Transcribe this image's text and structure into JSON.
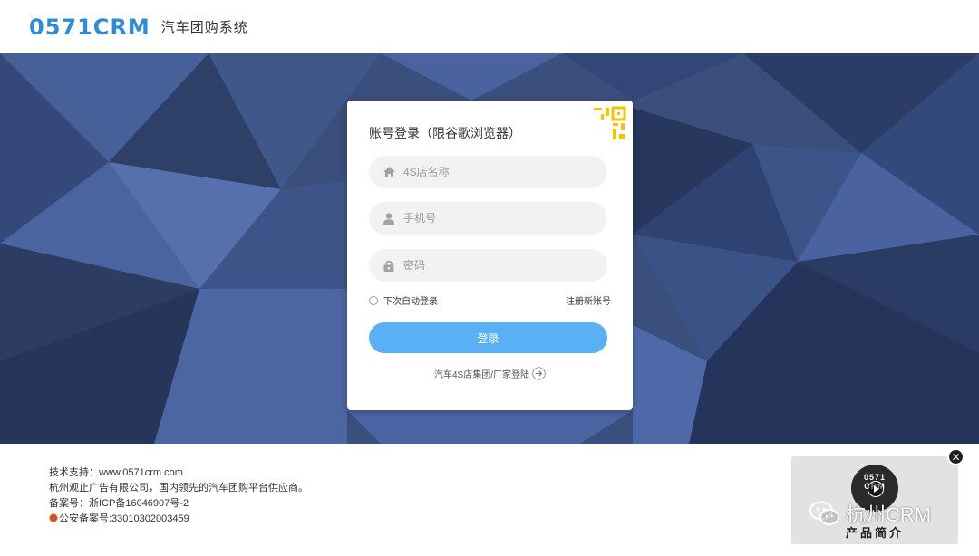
{
  "header": {
    "logo": "0571CRM",
    "title": "汽车团购系统"
  },
  "login": {
    "title": "账号登录（限谷歌浏览器）",
    "store_placeholder": "4S店名称",
    "phone_placeholder": "手机号",
    "password_placeholder": "密码",
    "remember_label": "下次自动登录",
    "register_label": "注册新账号",
    "submit_label": "登录",
    "group_login_label": "汽车4S店集团/厂家登陆"
  },
  "footer": {
    "support": "技术支持：www.0571crm.com",
    "company": "杭州观止广告有限公司，国内领先的汽车团购平台供应商。",
    "icp": "备案号：浙ICP备16046907号-2",
    "police": "公安备案号:33010302003459"
  },
  "video_popup": {
    "logo_line1": "0571",
    "logo_line2": "CRM",
    "label": "产品简介"
  },
  "watermark": {
    "text": "杭州CRM"
  },
  "colors": {
    "brand": "#2f8bd9",
    "button": "#5ab0f5",
    "background": "#3a4f7c",
    "qr_accent": "#f5c400"
  }
}
